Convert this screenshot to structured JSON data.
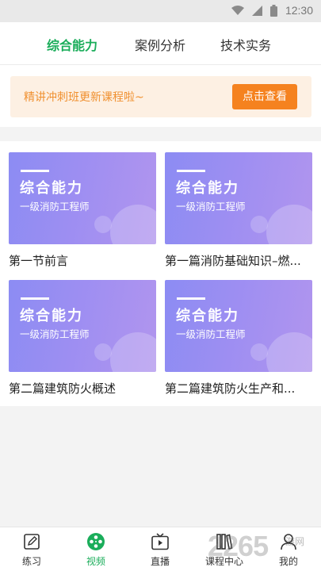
{
  "status_bar": {
    "time": "12:30",
    "icons": [
      "wifi-icon",
      "signal-icon",
      "battery-icon"
    ]
  },
  "tabs": [
    {
      "label": "综合能力",
      "active": true
    },
    {
      "label": "案例分析",
      "active": false
    },
    {
      "label": "技术实务",
      "active": false
    }
  ],
  "banner": {
    "text": "精讲冲刺班更新课程啦~",
    "button_label": "点击查看"
  },
  "courses": [
    {
      "thumb_title": "综合能力",
      "thumb_subtitle": "一级消防工程师",
      "title": "第一节前言"
    },
    {
      "thumb_title": "综合能力",
      "thumb_subtitle": "一级消防工程师",
      "title": "第一篇消防基础知识–燃..."
    },
    {
      "thumb_title": "综合能力",
      "thumb_subtitle": "一级消防工程师",
      "title": "第二篇建筑防火概述"
    },
    {
      "thumb_title": "综合能力",
      "thumb_subtitle": "一级消防工程师",
      "title": "第二篇建筑防火生产和..."
    }
  ],
  "bottom_nav": [
    {
      "label": "练习",
      "icon": "edit-icon",
      "active": false
    },
    {
      "label": "视频",
      "icon": "film-reel-icon",
      "active": true
    },
    {
      "label": "直播",
      "icon": "tv-play-icon",
      "active": false
    },
    {
      "label": "课程中心",
      "icon": "books-icon",
      "active": false
    },
    {
      "label": "我的",
      "icon": "user-icon",
      "active": false
    }
  ],
  "watermark": {
    "text": "2265",
    "suffix": "游网"
  },
  "colors": {
    "accent": "#1aad5a",
    "banner_bg": "#fdf0e3",
    "banner_button": "#f5821f",
    "banner_text": "#f0902f",
    "thumb_start": "#8c8cf3",
    "thumb_end": "#b195ee"
  }
}
